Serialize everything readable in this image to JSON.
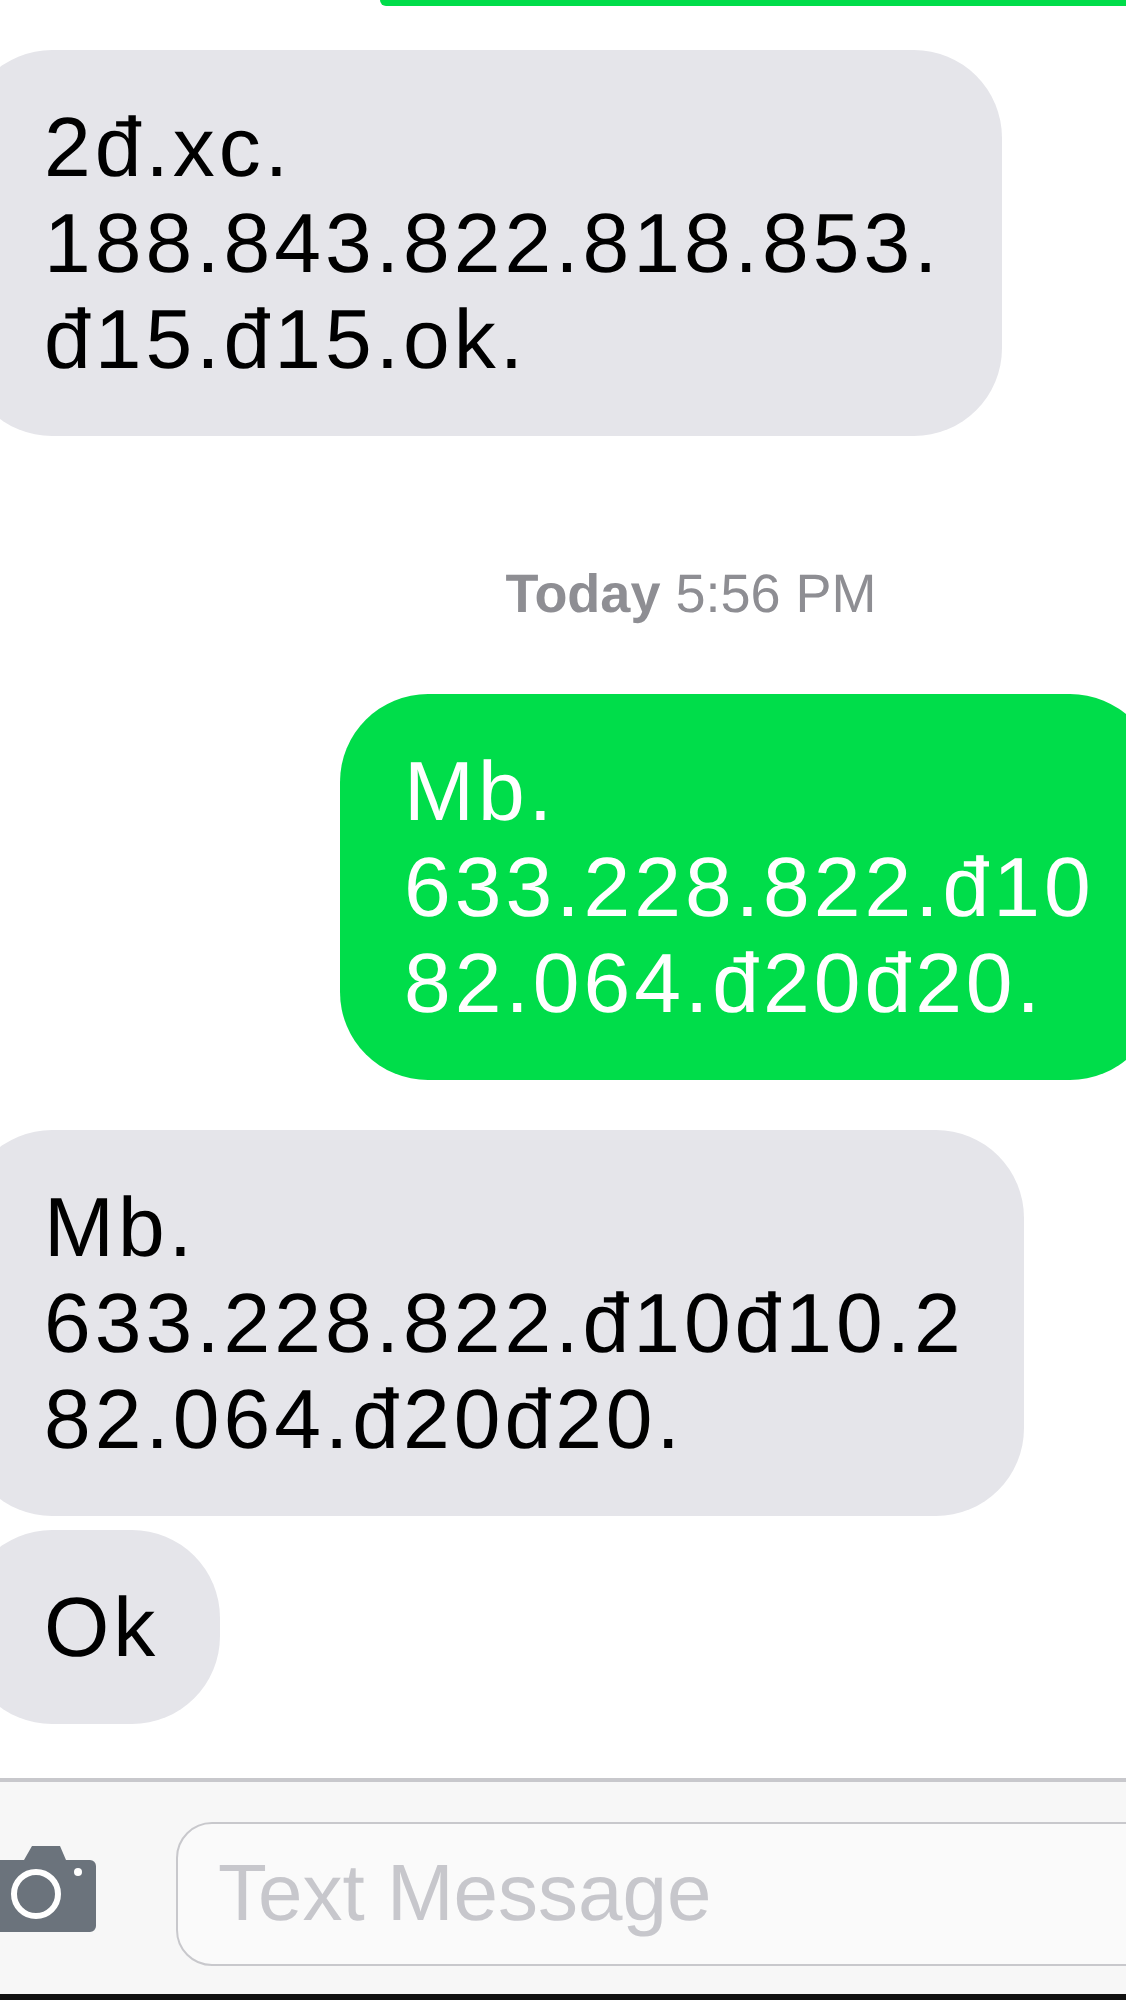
{
  "messages": [
    {
      "kind": "sent_cut"
    },
    {
      "kind": "received",
      "text": "2đ.xc.\n188.843.822.818.853.\nđ15.đ15.ok."
    },
    {
      "kind": "timestamp",
      "text": "**Today** 5:56 PM"
    },
    {
      "kind": "sent",
      "text": "Mb.\n633.228.822.đ10\n82.064.đ20đ20."
    },
    {
      "kind": "received",
      "text": "Mb.\n633.228.822.đ10đ10.2\n82.064.đ20đ20."
    },
    {
      "kind": "received",
      "text": "Ok"
    }
  ],
  "composer": {
    "placeholder": "Text Message"
  }
}
